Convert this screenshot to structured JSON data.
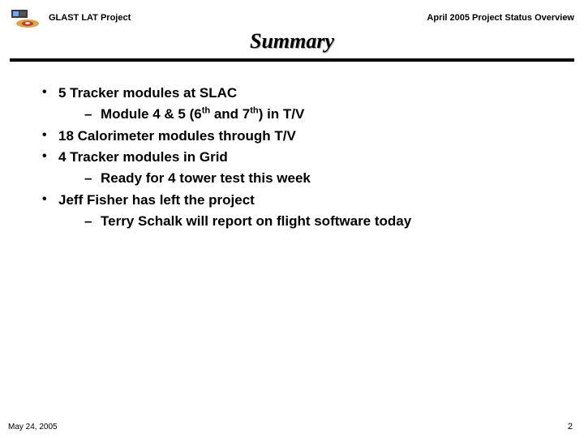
{
  "header": {
    "project": "GLAST LAT Project",
    "status": "April 2005 Project Status Overview"
  },
  "title": "Summary",
  "bullets": {
    "b1": "5 Tracker modules at SLAC",
    "b1a_pre": "Module 4 & 5 (6",
    "b1a_sup1": "th",
    "b1a_mid": " and 7",
    "b1a_sup2": "th",
    "b1a_post": ") in T/V",
    "b2": "18 Calorimeter modules through T/V",
    "b3": "4 Tracker modules in Grid",
    "b3a": "Ready for 4 tower test this week",
    "b4": "Jeff Fisher has left the project",
    "b4a": "Terry Schalk will report on flight software today"
  },
  "footer": {
    "date": "May 24, 2005",
    "page": "2"
  }
}
